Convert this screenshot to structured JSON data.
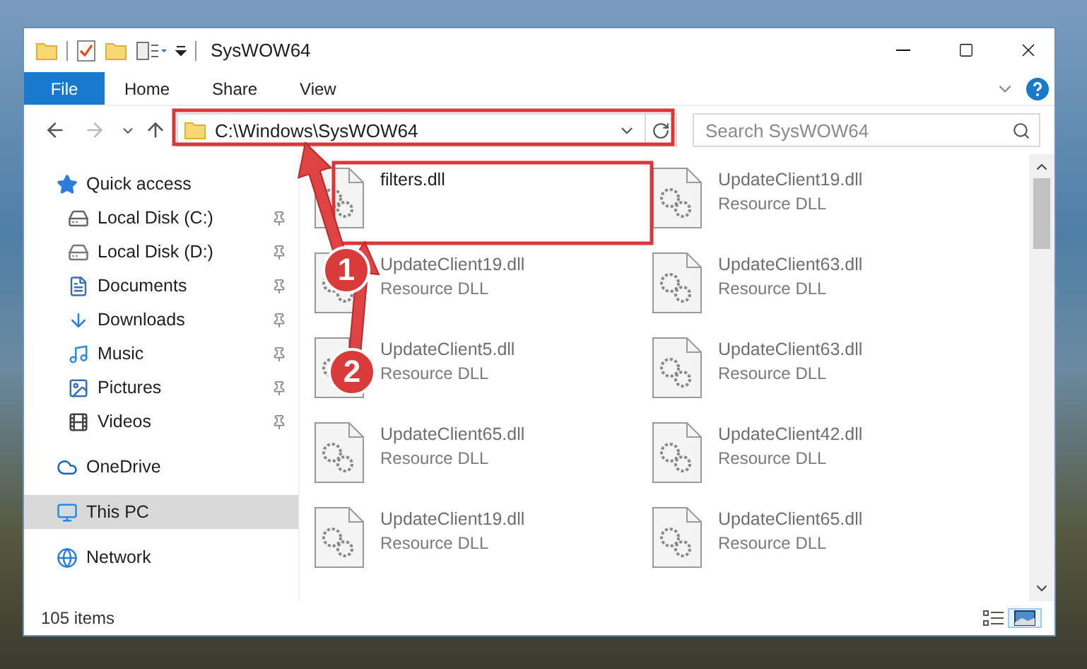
{
  "window": {
    "title": "SysWOW64"
  },
  "ribbon": {
    "tabs": [
      {
        "label": "File",
        "kind": "file"
      },
      {
        "label": "Home",
        "kind": "tab"
      },
      {
        "label": "Share",
        "kind": "tab"
      },
      {
        "label": "View",
        "kind": "tab"
      }
    ]
  },
  "address": {
    "path": "C:\\Windows\\SysWOW64"
  },
  "search": {
    "placeholder": "Search SysWOW64"
  },
  "nav": {
    "items": [
      {
        "label": "Quick access",
        "selected": false,
        "children": [
          {
            "label": "Local Disk (C:)",
            "pinned": true,
            "selected": false
          },
          {
            "label": "Local Disk (D:)",
            "pinned": true,
            "selected": false
          },
          {
            "label": "Documents",
            "pinned": true,
            "selected": false
          },
          {
            "label": "Downloads",
            "pinned": true,
            "selected": false
          },
          {
            "label": "Music",
            "pinned": true,
            "selected": false
          },
          {
            "label": "Pictures",
            "pinned": true,
            "selected": false
          },
          {
            "label": "Videos",
            "pinned": true,
            "selected": false
          }
        ]
      },
      {
        "label": "OneDrive",
        "selected": false
      },
      {
        "label": "This PC",
        "selected": true
      },
      {
        "label": "Network",
        "selected": false
      }
    ]
  },
  "files": [
    {
      "name": "filters.dll",
      "dimmed": false
    },
    {
      "name": "UpdateClient19.dll",
      "type": "Resource DLL",
      "dimmed": true
    },
    {
      "name": "UpdateClient19.dll",
      "type": "Resource DLL",
      "dimmed": true
    },
    {
      "name": "UpdateClient63.dll",
      "type": "Resource DLL",
      "dimmed": true
    },
    {
      "name": "UpdateClient5.dll",
      "type": "Resource DLL",
      "dimmed": true
    },
    {
      "name": "UpdateClient63.dll",
      "type": "Resource DLL",
      "dimmed": true
    },
    {
      "name": "UpdateClient65.dll",
      "type": "Resource DLL",
      "dimmed": true
    },
    {
      "name": "UpdateClient42.dll",
      "type": "Resource DLL",
      "dimmed": true
    },
    {
      "name": "UpdateClient19.dll",
      "type": "Resource DLL",
      "dimmed": true
    },
    {
      "name": "UpdateClient65.dll",
      "type": "Resource DLL",
      "dimmed": true
    }
  ],
  "status_bar": {
    "count": "105 items"
  },
  "callouts": [
    {
      "label": "1"
    },
    {
      "label": "2"
    }
  ]
}
